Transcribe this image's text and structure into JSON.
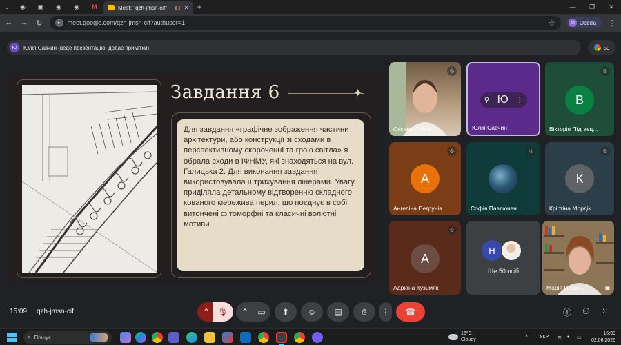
{
  "browser": {
    "active_tab_title": "Meet: \"qzh-jmsn-cif\"",
    "url": "meet.google.com/qzh-jmsn-cif?authuser=1",
    "profile_initial": "M",
    "profile_label": "Освіта"
  },
  "presenter": {
    "initial": "Ю",
    "text": "Юлія Савчин (веде презентацію, додає примітки)"
  },
  "participants_count": "59",
  "slide": {
    "title": "Завдання 6",
    "body": "Для завдання «графічне зображення частини архітектури, або конструкції зі сходами в перспективному скороченні та грою світла» я обрала сходи в ІФНМУ, які знаходяться на вул. Галицька 2. Для виконання завдання використовувала штрихування лінерами. Увагу приділяла детальному відтворенню складного кованого мережива перил, що поєднує в собі витончені фітоморфні та класичні волютні мотиви"
  },
  "tiles": [
    {
      "name": "Оксана Собок",
      "kind": "video"
    },
    {
      "name": "Юлія Савчин",
      "initial": "Ю",
      "kind": "presenter"
    },
    {
      "name": "Вікторія Підгаєц...",
      "initial": "В",
      "kind": "avatar",
      "color": "#0b8043"
    },
    {
      "name": "Ангеліна Петрунів",
      "initial": "А",
      "kind": "avatar",
      "color": "#e8710a"
    },
    {
      "name": "Софія Павлючен...",
      "kind": "image"
    },
    {
      "name": "Крістіна Мордік",
      "initial": "К",
      "kind": "avatar",
      "color": "#5f6368"
    },
    {
      "name": "Адріана Кузьмяк",
      "initial": "А",
      "kind": "avatar",
      "color": "#6d4c41"
    },
    {
      "name": "Ще 50 осіб",
      "initial": "Н",
      "kind": "more"
    },
    {
      "name": "Марія Пазин...",
      "kind": "video"
    }
  ],
  "controls": {
    "time": "15:09",
    "meeting_code": "qzh-jmsn-cif"
  },
  "taskbar": {
    "search_placeholder": "Пошук",
    "temperature": "16°C",
    "weather": "Cloudy",
    "language": "УКР",
    "clock_time": "15:09",
    "clock_date": "02.06.2026"
  },
  "colors": {
    "meet_bg": "#202124",
    "slide_bg": "#231e20",
    "text_box": "#e6dcc8",
    "end_call": "#ea4335",
    "presenter_tile": "#5b2a8a"
  }
}
